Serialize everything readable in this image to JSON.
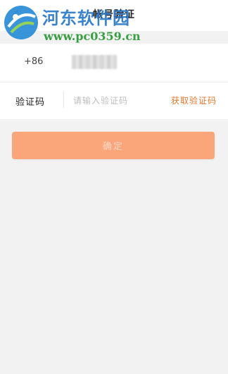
{
  "header": {
    "title": "帐号验证",
    "back_icon": "chevron-left-icon"
  },
  "watermark": {
    "name": "河东软件园",
    "url": "www.pc0359.cn"
  },
  "phone_row": {
    "country_code": "+86"
  },
  "code_row": {
    "label": "验证码",
    "placeholder": "请输入验证码",
    "get_code": "获取验证码"
  },
  "confirm_label": "确定",
  "colors": {
    "accent": "#e0782c",
    "button": "#fba67a",
    "logo_blue": "#2a78c8",
    "logo_green": "#2f9a3a"
  }
}
